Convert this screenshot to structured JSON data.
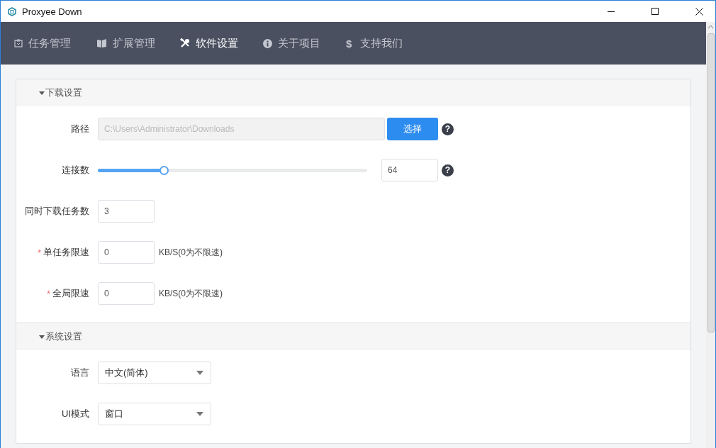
{
  "window": {
    "title": "Proxyee Down"
  },
  "tabs": [
    {
      "label": "任务管理",
      "selected": false
    },
    {
      "label": "扩展管理",
      "selected": false
    },
    {
      "label": "软件设置",
      "selected": true
    },
    {
      "label": "关于项目",
      "selected": false
    },
    {
      "label": "支持我们",
      "selected": false,
      "glyph": "$"
    }
  ],
  "sections": [
    {
      "title": "下载设置",
      "expanded": true,
      "rows": [
        {
          "kind": "path",
          "label": "路径",
          "value": "C:\\Users\\Administrator\\Downloads",
          "disabled": true,
          "button": "选择",
          "help": "?"
        },
        {
          "kind": "slider",
          "label": "连接数",
          "level": 0.245,
          "value": "64",
          "help": "?"
        },
        {
          "kind": "number",
          "label": "同时下载任务数",
          "value": "3"
        },
        {
          "kind": "number",
          "label": "单任务限速",
          "marker": "*",
          "value": "0",
          "suffix": "KB/S(0为不限速)"
        },
        {
          "kind": "number",
          "label": "全局限速",
          "marker": "*",
          "value": "0",
          "suffix": "KB/S(0为不限速)"
        }
      ]
    },
    {
      "title": "系统设置",
      "expanded": true,
      "rows": [
        {
          "kind": "select",
          "label": "语言",
          "value": "中文(简体)"
        },
        {
          "kind": "select",
          "label": "UI模式",
          "value": "窗口"
        }
      ]
    }
  ]
}
